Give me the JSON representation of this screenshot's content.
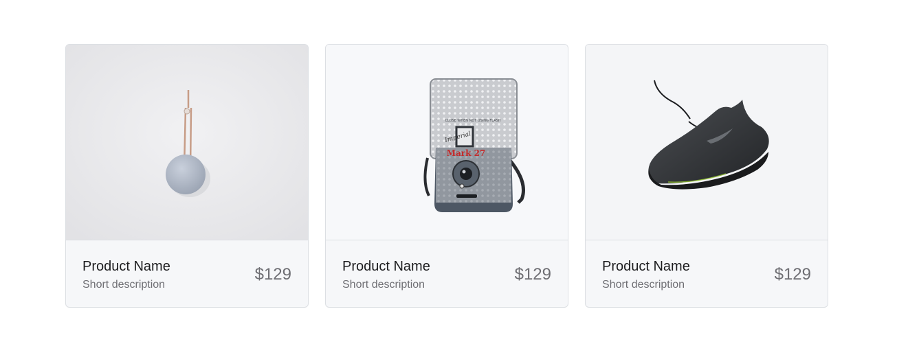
{
  "products": [
    {
      "name": "Product Name",
      "description": "Short description",
      "price": "$129",
      "image": "round-speaker-image"
    },
    {
      "name": "Product Name",
      "description": "Short description",
      "price": "$129",
      "image": "instant-camera-image",
      "image_text": {
        "brand_script": "Imperial",
        "model": "Mark 27",
        "warning": "CLOSE WHEN NOT USING FLASH"
      }
    },
    {
      "name": "Product Name",
      "description": "Short description",
      "price": "$129",
      "image": "black-sneaker-image"
    }
  ],
  "colors": {
    "card_border": "#dcdfe3",
    "card_footer_bg": "#f6f7f9",
    "title_text": "#1d1d1f",
    "muted_text": "#6e6e73"
  }
}
